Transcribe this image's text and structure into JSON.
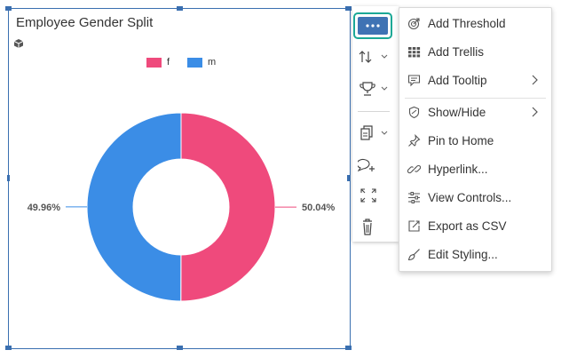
{
  "widget": {
    "title": "Employee Gender Split"
  },
  "chart_data": {
    "type": "pie",
    "donut": true,
    "title": "Employee Gender Split",
    "categories": [
      "f",
      "m"
    ],
    "values": [
      50.04,
      49.96
    ],
    "labels": [
      "50.04%",
      "49.96%"
    ],
    "colors": [
      "#ef4a7c",
      "#3b8de6"
    ],
    "legend": [
      {
        "name": "f",
        "color": "#ef4a7c"
      },
      {
        "name": "m",
        "color": "#3b8de6"
      }
    ],
    "legend_position": "top"
  },
  "toolbar": {
    "items": [
      {
        "name": "more-options",
        "icon": "more-icon"
      },
      {
        "name": "sort",
        "icon": "sort-icon"
      },
      {
        "name": "rank",
        "icon": "trophy-icon"
      },
      {
        "name": "copy",
        "icon": "copy-icon"
      },
      {
        "name": "comment",
        "icon": "add-comment-icon"
      },
      {
        "name": "fullscreen",
        "icon": "fullscreen-icon"
      },
      {
        "name": "delete",
        "icon": "trash-icon"
      }
    ]
  },
  "menu": {
    "items": [
      {
        "label": "Add Threshold",
        "icon": "threshold-icon",
        "submenu": false
      },
      {
        "label": "Add Trellis",
        "icon": "grid-icon",
        "submenu": false
      },
      {
        "label": "Add Tooltip",
        "icon": "tooltip-icon",
        "submenu": true
      },
      {
        "label": "Show/Hide",
        "icon": "shield-icon",
        "submenu": true
      },
      {
        "label": "Pin to Home",
        "icon": "pin-icon",
        "submenu": false
      },
      {
        "label": "Hyperlink...",
        "icon": "link-icon",
        "submenu": false
      },
      {
        "label": "View Controls...",
        "icon": "sliders-icon",
        "submenu": false
      },
      {
        "label": "Export as CSV",
        "icon": "export-icon",
        "submenu": false
      },
      {
        "label": "Edit Styling...",
        "icon": "brush-icon",
        "submenu": false
      }
    ]
  }
}
